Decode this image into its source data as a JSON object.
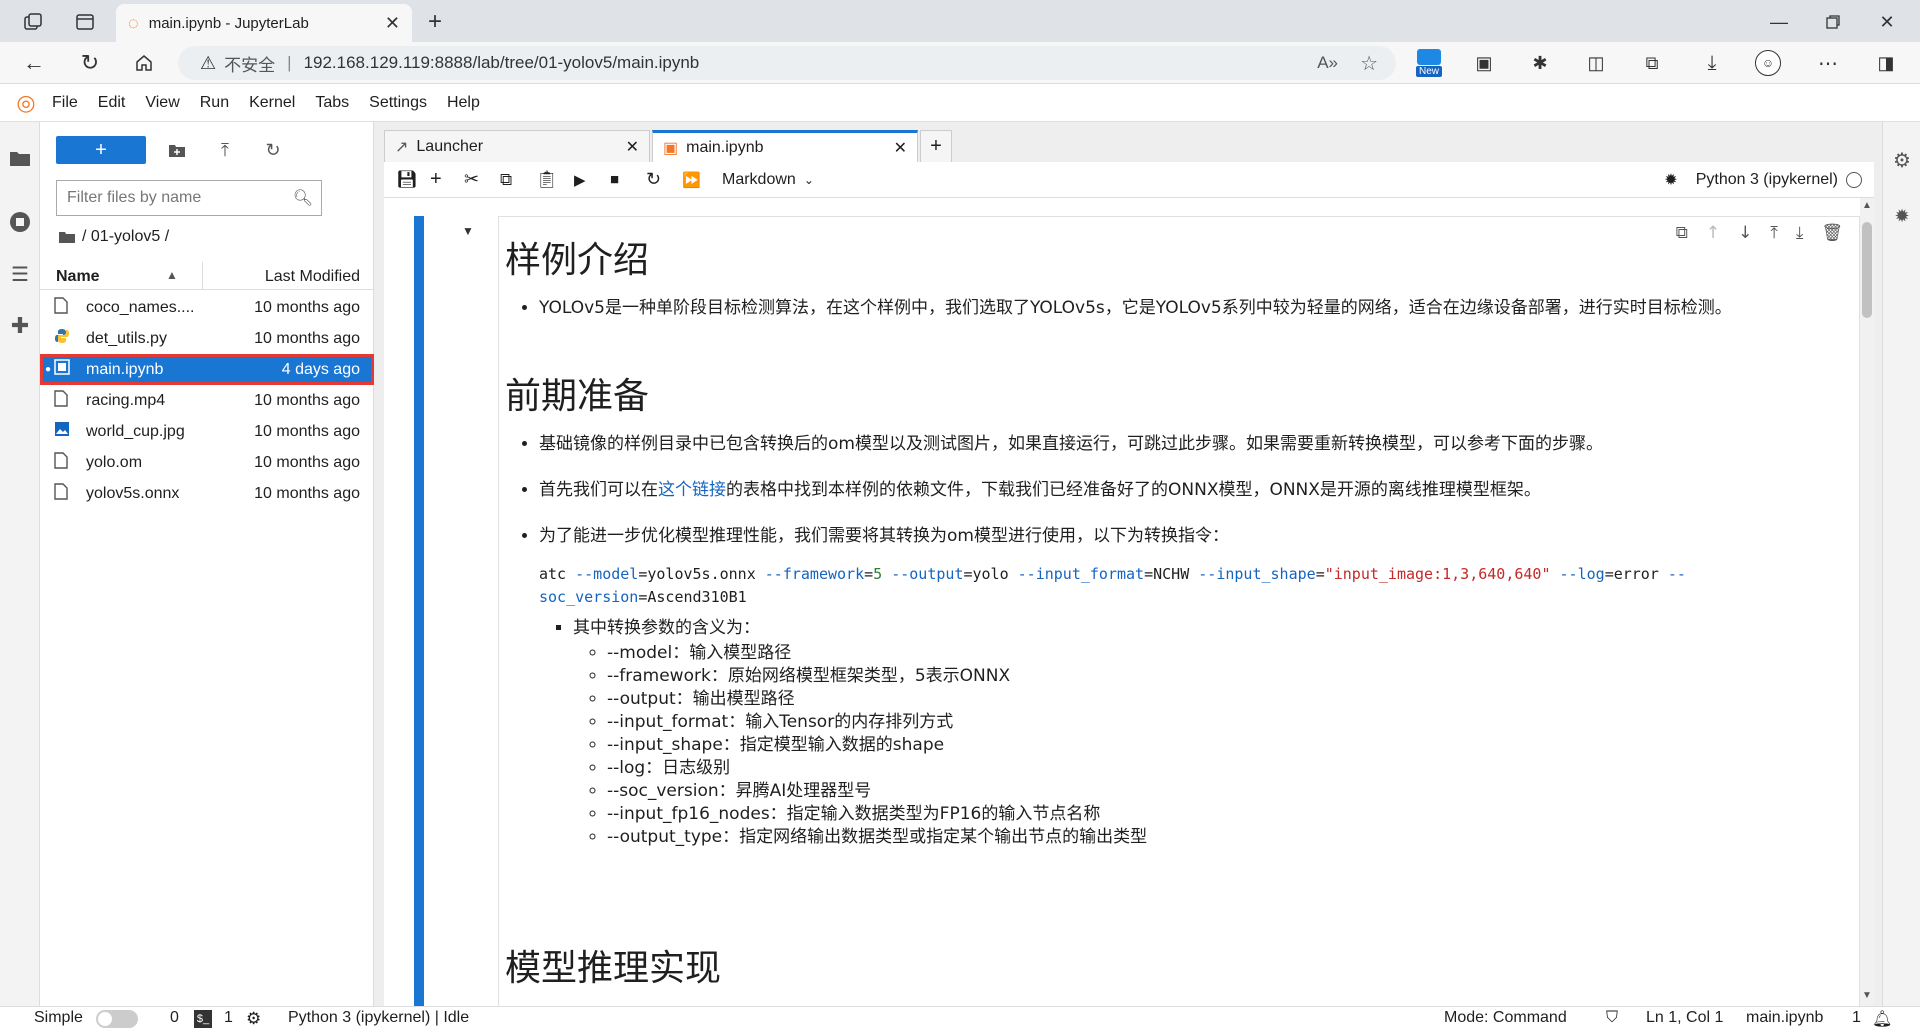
{
  "browser": {
    "tab_title": "main.ipynb - JupyterLab",
    "insecure_label": "不安全",
    "url": "192.168.129.119:8888/lab/tree/01-yolov5/main.ipynb",
    "new_badge": "New"
  },
  "menu": [
    "File",
    "Edit",
    "View",
    "Run",
    "Kernel",
    "Tabs",
    "Settings",
    "Help"
  ],
  "file_browser": {
    "new_button": "+",
    "filter_placeholder": "Filter files by name",
    "breadcrumb": "/ 01-yolov5 /",
    "col_name": "Name",
    "col_modified": "Last Modified",
    "files": [
      {
        "name": "coco_names....",
        "modified": "10 months ago",
        "icon": "file-icon"
      },
      {
        "name": "det_utils.py",
        "modified": "10 months ago",
        "icon": "python-icon"
      },
      {
        "name": "main.ipynb",
        "modified": "4 days ago",
        "icon": "notebook-icon",
        "selected": true
      },
      {
        "name": "racing.mp4",
        "modified": "10 months ago",
        "icon": "file-icon"
      },
      {
        "name": "world_cup.jpg",
        "modified": "10 months ago",
        "icon": "image-icon"
      },
      {
        "name": "yolo.om",
        "modified": "10 months ago",
        "icon": "file-icon"
      },
      {
        "name": "yolov5s.onnx",
        "modified": "10 months ago",
        "icon": "file-icon"
      }
    ]
  },
  "doc_tabs": [
    {
      "label": "Launcher"
    },
    {
      "label": "main.ipynb"
    }
  ],
  "toolbar": {
    "cell_type": "Markdown",
    "kernel": "Python 3 (ipykernel)"
  },
  "notebook": {
    "h1_a": "样例介绍",
    "p_a1": "YOLOv5是一种单阶段目标检测算法，在这个样例中，我们选取了YOLOv5s，它是YOLOv5系列中较为轻量的网络，适合在边缘设备部署，进行实时目标检测。",
    "h1_b": "前期准备",
    "p_b1": "基础镜像的样例目录中已包含转换后的om模型以及测试图片，如果直接运行，可跳过此步骤。如果需要重新转换模型，可以参考下面的步骤。",
    "p_b2_pre": "首先我们可以在",
    "p_b2_link": "这个链接",
    "p_b2_post": "的表格中找到本样例的依赖文件，下载我们已经准备好了的ONNX模型，ONNX是开源的离线推理模型框架。",
    "p_b3": "为了能进一步优化模型推理性能，我们需要将其转换为om模型进行使用，以下为转换指令：",
    "code": {
      "t1": "atc ",
      "t2": "--model",
      "t3": "=yolov5s.onnx ",
      "t4": "--framework",
      "t5": "=",
      "t6": "5",
      "t7": " ",
      "t8": "--output",
      "t9": "=yolo ",
      "t10": "--input_format",
      "t11": "=NCHW ",
      "t12": "--input_shape",
      "t13": "=",
      "t14": "\"input_image:1,3,640,640\"",
      "t15": " ",
      "t16": "--log",
      "t17": "=error ",
      "t18": "--",
      "t19": "soc_version",
      "t20": "=Ascend310B1"
    },
    "sub_title": "其中转换参数的含义为：",
    "params": [
      "--model：输入模型路径",
      "--framework：原始网络模型框架类型，5表示ONNX",
      "--output：输出模型路径",
      "--input_format：输入Tensor的内存排列方式",
      "--input_shape：指定模型输入数据的shape",
      "--log：日志级别",
      "--soc_version：昇腾AI处理器型号",
      "--input_fp16_nodes：指定输入数据类型为FP16的输入节点名称",
      "--output_type：指定网络输出数据类型或指定某个输出节点的输出类型"
    ],
    "h1_c": "模型推理实现"
  },
  "status": {
    "mode_label": "Simple",
    "count_a": "0",
    "count_b": "1",
    "kernel_status": "Python 3 (ipykernel) | Idle",
    "mode": "Mode: Command",
    "position": "Ln 1, Col 1",
    "filename": "main.ipynb",
    "notifications": "1"
  },
  "colors": {
    "accent": "#1976d2",
    "highlight": "#e53935"
  }
}
